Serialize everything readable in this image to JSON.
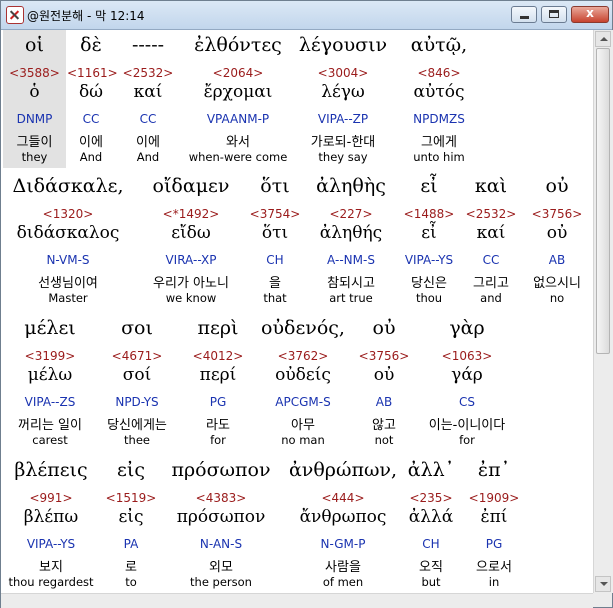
{
  "window": {
    "title": "@원전분해 - 막 12:14",
    "buttons": {
      "minimize": "minimize",
      "maximize": "maximize",
      "close": "x"
    }
  },
  "lines": [
    {
      "words": [
        {
          "greek": "οἱ",
          "strong": "<3588>",
          "lemma": "ὁ",
          "parse": "DNMP",
          "korean": "그들이",
          "english": "they"
        },
        {
          "greek": "δὲ",
          "strong": "<1161>",
          "lemma": "δώ",
          "parse": "CC",
          "korean": "이에",
          "english": "And"
        },
        {
          "greek": "-----",
          "strong": "<2532>",
          "lemma": "καί",
          "parse": "CC",
          "korean": "이에",
          "english": "And"
        },
        {
          "greek": "ἐλθόντες",
          "strong": "<2064>",
          "lemma": "ἔρχομαι",
          "parse": "VPAANM-P",
          "korean": "와서",
          "english": "when-were come"
        },
        {
          "greek": "λέγουσιν",
          "strong": "<3004>",
          "lemma": "λέγω",
          "parse": "VIPA--ZP",
          "korean": "가로되-한대",
          "english": "they say"
        },
        {
          "greek": "αὐτῷ,",
          "strong": "<846>",
          "lemma": "αὐτός",
          "parse": "NPDMZS",
          "korean": "그에게",
          "english": "unto him"
        }
      ]
    },
    {
      "words": [
        {
          "greek": "Διδάσκαλε,",
          "strong": "<1320>",
          "lemma": "διδάσκαλος",
          "parse": "N-VM-S",
          "korean": "선생님이여",
          "english": "Master"
        },
        {
          "greek": "οἴδαμεν",
          "strong": "<*1492>",
          "lemma": "εἴδω",
          "parse": "VIRA--XP",
          "korean": "우리가 아노니",
          "english": "we know"
        },
        {
          "greek": "ὅτι",
          "strong": "<3754>",
          "lemma": "ὅτι",
          "parse": "CH",
          "korean": "을",
          "english": "that"
        },
        {
          "greek": "ἀληθὴς",
          "strong": "<227>",
          "lemma": "ἀληθής",
          "parse": "A--NM-S",
          "korean": "참되시고",
          "english": "art true"
        },
        {
          "greek": "εἶ",
          "strong": "<1488>",
          "lemma": "εἶ",
          "parse": "VIPA--YS",
          "korean": "당신은",
          "english": "thou"
        },
        {
          "greek": "καὶ",
          "strong": "<2532>",
          "lemma": "καί",
          "parse": "CC",
          "korean": "그리고",
          "english": "and"
        },
        {
          "greek": "οὐ",
          "strong": "<3756>",
          "lemma": "οὐ",
          "parse": "AB",
          "korean": "없으시니",
          "english": "no"
        }
      ]
    },
    {
      "words": [
        {
          "greek": "μέλει",
          "strong": "<3199>",
          "lemma": "μέλω",
          "parse": "VIPA--ZS",
          "korean": "꺼리는 일이",
          "english": "carest"
        },
        {
          "greek": "σοι",
          "strong": "<4671>",
          "lemma": "σοί",
          "parse": "NPD-YS",
          "korean": "당신에게는",
          "english": "thee"
        },
        {
          "greek": "περὶ",
          "strong": "<4012>",
          "lemma": "περί",
          "parse": "PG",
          "korean": "라도",
          "english": "for"
        },
        {
          "greek": "οὐδενός,",
          "strong": "<3762>",
          "lemma": "οὐδείς",
          "parse": "APCGM-S",
          "korean": "아무",
          "english": "no man"
        },
        {
          "greek": "οὐ",
          "strong": "<3756>",
          "lemma": "οὐ",
          "parse": "AB",
          "korean": "않고",
          "english": "not"
        },
        {
          "greek": "γὰρ",
          "strong": "<1063>",
          "lemma": "γάρ",
          "parse": "CS",
          "korean": "이는-이니이다",
          "english": "for"
        }
      ]
    },
    {
      "words": [
        {
          "greek": "βλέπεις",
          "strong": "<991>",
          "lemma": "βλέπω",
          "parse": "VIPA--YS",
          "korean": "보지",
          "english": "thou regardest"
        },
        {
          "greek": "εἰς",
          "strong": "<1519>",
          "lemma": "εἰς",
          "parse": "PA",
          "korean": "로",
          "english": "to"
        },
        {
          "greek": "πρόσωπον",
          "strong": "<4383>",
          "lemma": "πρόσωπον",
          "parse": "N-AN-S",
          "korean": "외모",
          "english": "the person"
        },
        {
          "greek": "ἀνθρώπων,",
          "strong": "<444>",
          "lemma": "ἄνθρωπος",
          "parse": "N-GM-P",
          "korean": "사람을",
          "english": "of men"
        },
        {
          "greek": "ἀλλ᾽",
          "strong": "<235>",
          "lemma": "ἀλλά",
          "parse": "CH",
          "korean": "오직",
          "english": "but"
        },
        {
          "greek": "ἐπ᾽",
          "strong": "<1909>",
          "lemma": "ἐπί",
          "parse": "PG",
          "korean": "으로서",
          "english": "in"
        }
      ]
    }
  ]
}
